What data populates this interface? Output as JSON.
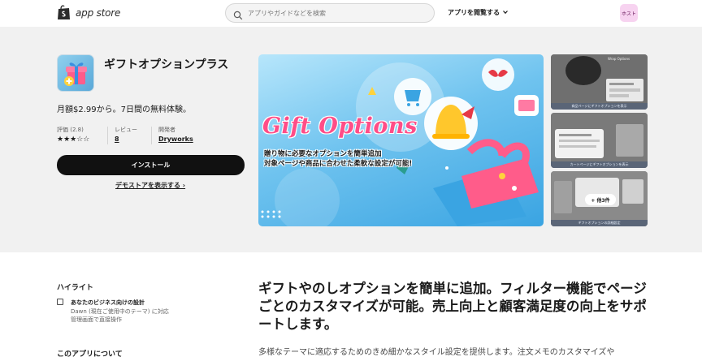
{
  "header": {
    "logo_text": "app store",
    "search_placeholder": "アプリやガイドなどを検索",
    "browse_label": "アプリを閲覧する",
    "avatar_label": "ホスト"
  },
  "app": {
    "title": "ギフトオプションプラス",
    "pricing": "月額$2.99から。7日間の無料体験。",
    "rating_label": "評価 (2.8)",
    "rating_stars": "★★★☆☆",
    "rating_value": 2.8,
    "reviews_label": "レビュー",
    "reviews_count": "8",
    "developer_label": "開発者",
    "developer_name": "Dryworks",
    "install_label": "インストール",
    "demo_label": "デモストアを表示する ›"
  },
  "banner": {
    "title": "Gift Options",
    "subtitle_line1": "贈り物に必要なオプションを簡単追加",
    "subtitle_line2": "対象ページや商品に合わせた柔軟な設定が可能!"
  },
  "thumbnails": [
    {
      "caption": "商品ページにギフトオプションを表示",
      "header": "Wrap Options"
    },
    {
      "caption": "カートページにギフトオプションを表示"
    },
    {
      "caption": "ギフトオプションの詳細設定",
      "more_label": "+ 他3件"
    }
  ],
  "highlights": {
    "title": "ハイライト",
    "item_title": "あなたのビジネス向けの設計",
    "item_lines": [
      "Dawn (現在ご使用中のテーマ) に対応",
      "管理画面で直接操作"
    ]
  },
  "about_title": "このアプリについて",
  "headline": "ギフトやのしオプションを簡単に追加。フィルター機能でページごとのカスタマイズが可能。売上向上と顧客満足度の向上をサポートします。",
  "description": "多様なテーマに適応するためのきめ細かなスタイル設定を提供します。注文メモのカスタマイズや",
  "colors": {
    "accent_pink": "#ff4d87",
    "install_bg": "#111111",
    "hero_bg": "#f1f1f1"
  }
}
